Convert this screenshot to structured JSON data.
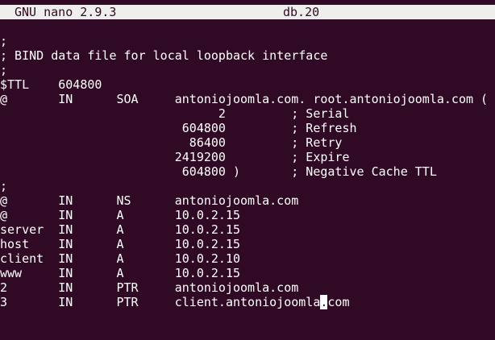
{
  "titlebar": {
    "app": "GNU nano 2.9.3",
    "filename": "db.20"
  },
  "buffer": {
    "lines": [
      ";",
      "; BIND data file for local loopback interface",
      ";",
      "$TTL    604800",
      "@       IN      SOA     antoniojoomla.com. root.antoniojoomla.com (",
      "                              2         ; Serial",
      "                         604800         ; Refresh",
      "                          86400         ; Retry",
      "                        2419200         ; Expire",
      "                         604800 )       ; Negative Cache TTL",
      ";",
      "@       IN      NS      antoniojoomla.com",
      "@       IN      A       10.0.2.15",
      "server  IN      A       10.0.2.15",
      "host    IN      A       10.0.2.15",
      "client  IN      A       10.0.2.10",
      "www     IN      A       10.0.2.15",
      "2       IN      PTR     antoniojoomla.com"
    ],
    "cursor_line_before": "3       IN      PTR     client.antoniojoomla",
    "cursor_char": ".",
    "cursor_line_after": "com"
  }
}
